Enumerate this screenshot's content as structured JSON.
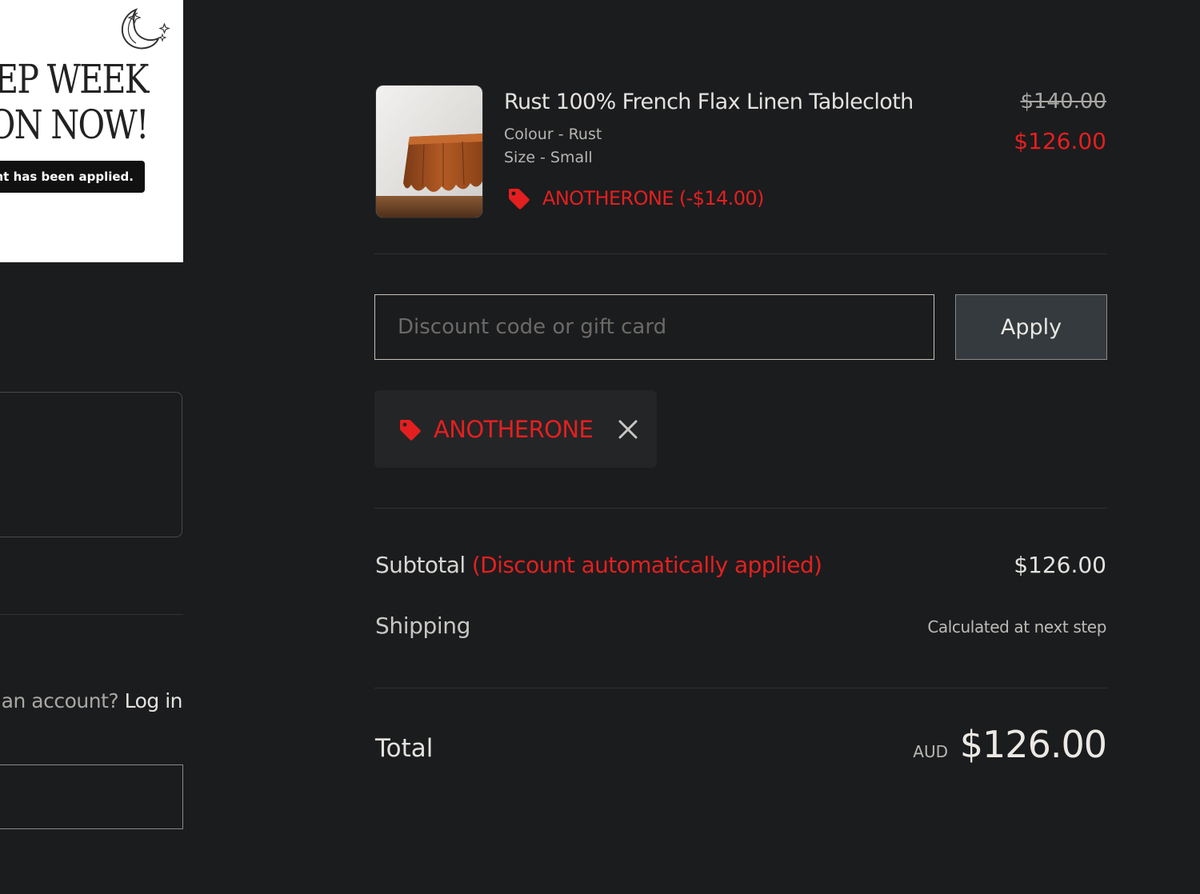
{
  "promo": {
    "line1": "EP WEEK",
    "line2": "ON NOW!",
    "pill": "unt has been applied."
  },
  "account": {
    "prompt": "an account?",
    "login_link": "Log in"
  },
  "line_item": {
    "title": "Rust 100% French Flax Linen Tablecloth",
    "colour": "Colour - Rust",
    "size": "Size - Small",
    "discount": "ANOTHERONE (-$14.00)",
    "original_price": "$140.00",
    "price": "$126.00"
  },
  "discount_form": {
    "placeholder": "Discount code or gift card",
    "apply_label": "Apply"
  },
  "applied_code": {
    "code": "ANOTHERONE"
  },
  "summary": {
    "subtotal_label": "Subtotal",
    "subtotal_note": "(Discount automatically applied)",
    "subtotal_value": "$126.00",
    "shipping_label": "Shipping",
    "shipping_value": "Calculated at next step",
    "total_label": "Total",
    "total_currency": "AUD",
    "total_value": "$126.00"
  },
  "colors": {
    "background": "#1b1c1e",
    "accent_red": "#e3201f",
    "chip_bg": "#242527",
    "apply_bg": "#343a3d"
  },
  "icons": {
    "tag": "tag-icon",
    "remove": "close-icon",
    "moon": "moon-icon"
  }
}
